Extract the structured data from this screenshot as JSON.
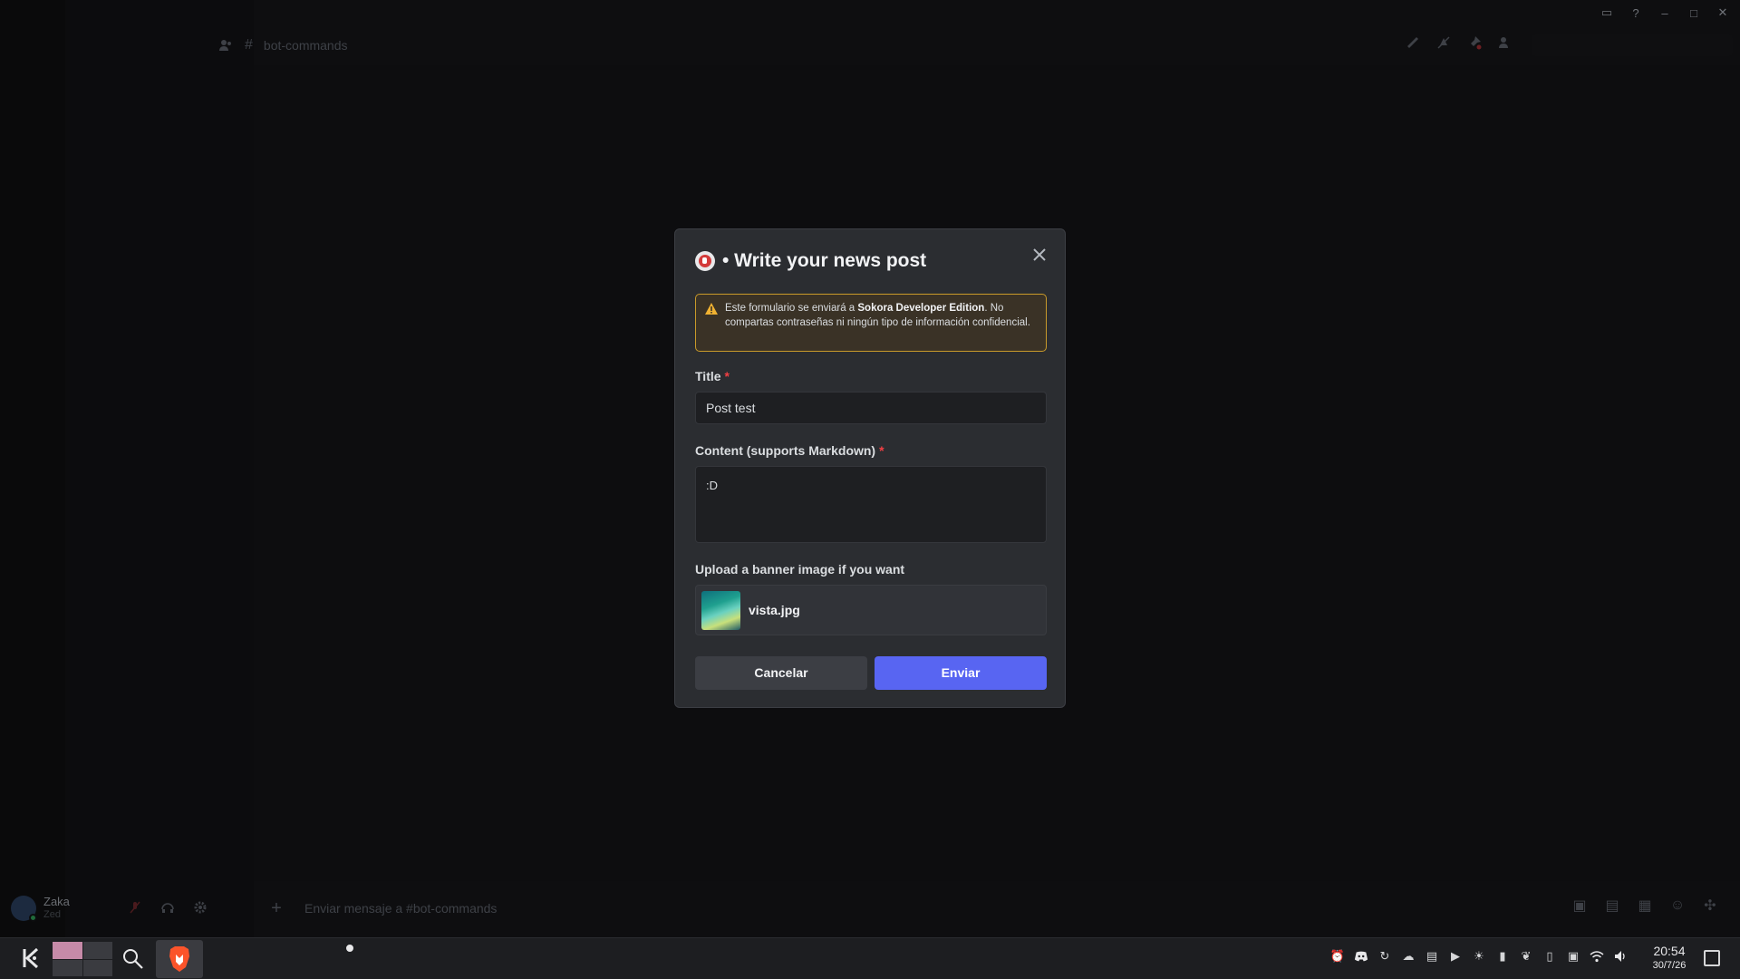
{
  "window": {
    "controls": [
      "–",
      "□",
      "✕"
    ]
  },
  "channel": {
    "name": "bot-commands",
    "hash": "#"
  },
  "user": {
    "name": "Zaka",
    "status": "Zed"
  },
  "composer": {
    "placeholder": "Enviar mensaje a #bot-commands"
  },
  "modal": {
    "title": "• Write your news post",
    "warning_prefix": "Este formulario se enviará a ",
    "warning_bold": "Sokora Developer Edition",
    "warning_suffix": ". No compartas contraseñas ni ningún tipo de información confidencial.",
    "fields": {
      "title_label": "Title",
      "title_value": "Post test",
      "content_label": "Content (supports Markdown)",
      "content_value": ":D",
      "upload_label": "Upload a banner image if you want",
      "upload_file": "vista.jpg",
      "required_marker": "*"
    },
    "buttons": {
      "cancel": "Cancelar",
      "submit": "Enviar"
    }
  },
  "taskbar": {
    "time": "20:54",
    "date": "30/7/26",
    "tray_icons": [
      "alarm-icon",
      "discord-icon",
      "update-icon",
      "weather-icon",
      "clipboard-icon",
      "media-play-icon",
      "brightness-icon",
      "usb-icon",
      "leaf-icon",
      "battery-icon",
      "sim-icon",
      "wifi-icon",
      "volume-icon"
    ]
  },
  "colors": {
    "accent": "#5865f2",
    "warning_border": "#c99a2a",
    "required": "#f23f43"
  }
}
